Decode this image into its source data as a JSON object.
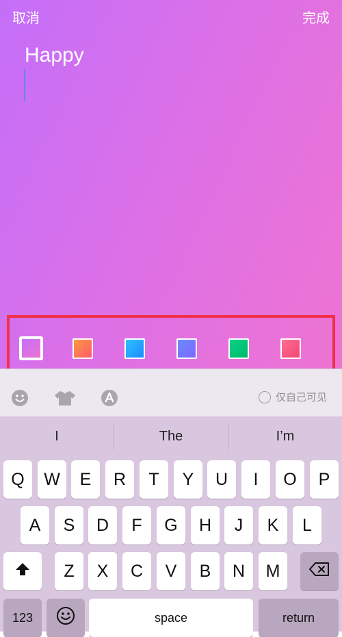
{
  "header": {
    "cancel_label": "取消",
    "done_label": "完成"
  },
  "editor": {
    "text": "Happy"
  },
  "colors": {
    "accent_highlight": "#f1304a",
    "editor_gradient": [
      "#c46ff9",
      "#ee74d2"
    ],
    "swatches": [
      "#c46ff9",
      "#ff9a3c",
      "#2ec1ff",
      "#6a8bff",
      "#08d386",
      "#ff6f8d",
      "#20c6ff"
    ]
  },
  "toolbar": {
    "icons": [
      "emoji-icon",
      "tshirt-icon",
      "font-style-icon"
    ],
    "private_label": "仅自己可见"
  },
  "keyboard": {
    "suggestions": [
      "I",
      "The",
      "I’m"
    ],
    "row1": [
      "Q",
      "W",
      "E",
      "R",
      "T",
      "Y",
      "U",
      "I",
      "O",
      "P"
    ],
    "row2": [
      "A",
      "S",
      "D",
      "F",
      "G",
      "H",
      "J",
      "K",
      "L"
    ],
    "row3": [
      "Z",
      "X",
      "C",
      "V",
      "B",
      "N",
      "M"
    ],
    "numbers_label": "123",
    "space_label": "space",
    "return_label": "return"
  }
}
